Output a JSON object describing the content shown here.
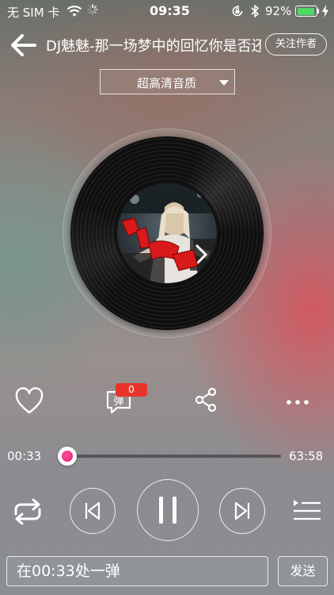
{
  "status_bar": {
    "carrier": "无 SIM 卡",
    "time": "09:35",
    "battery_percent": "92%",
    "battery_level": 0.92,
    "icons": [
      "wifi-icon",
      "activity-spinner-icon",
      "orientation-lock-icon",
      "bluetooth-icon",
      "battery-icon",
      "charging-bolt-icon"
    ]
  },
  "header": {
    "title": "DJ魅魅-那一场梦中的回忆你是否还",
    "follow_label": "关注作者"
  },
  "quality": {
    "selected": "超高清音质"
  },
  "actions": {
    "danmu_icon_text": "弹",
    "danmu_count": "0"
  },
  "progress": {
    "current": "00:33",
    "total": "63:58",
    "fraction": 0.009
  },
  "comment": {
    "placeholder": "在00:33处一弹",
    "send_label": "发送"
  },
  "colors": {
    "accent": "#ff3b6e",
    "badge": "#e8342a",
    "battery": "#4cd964"
  }
}
